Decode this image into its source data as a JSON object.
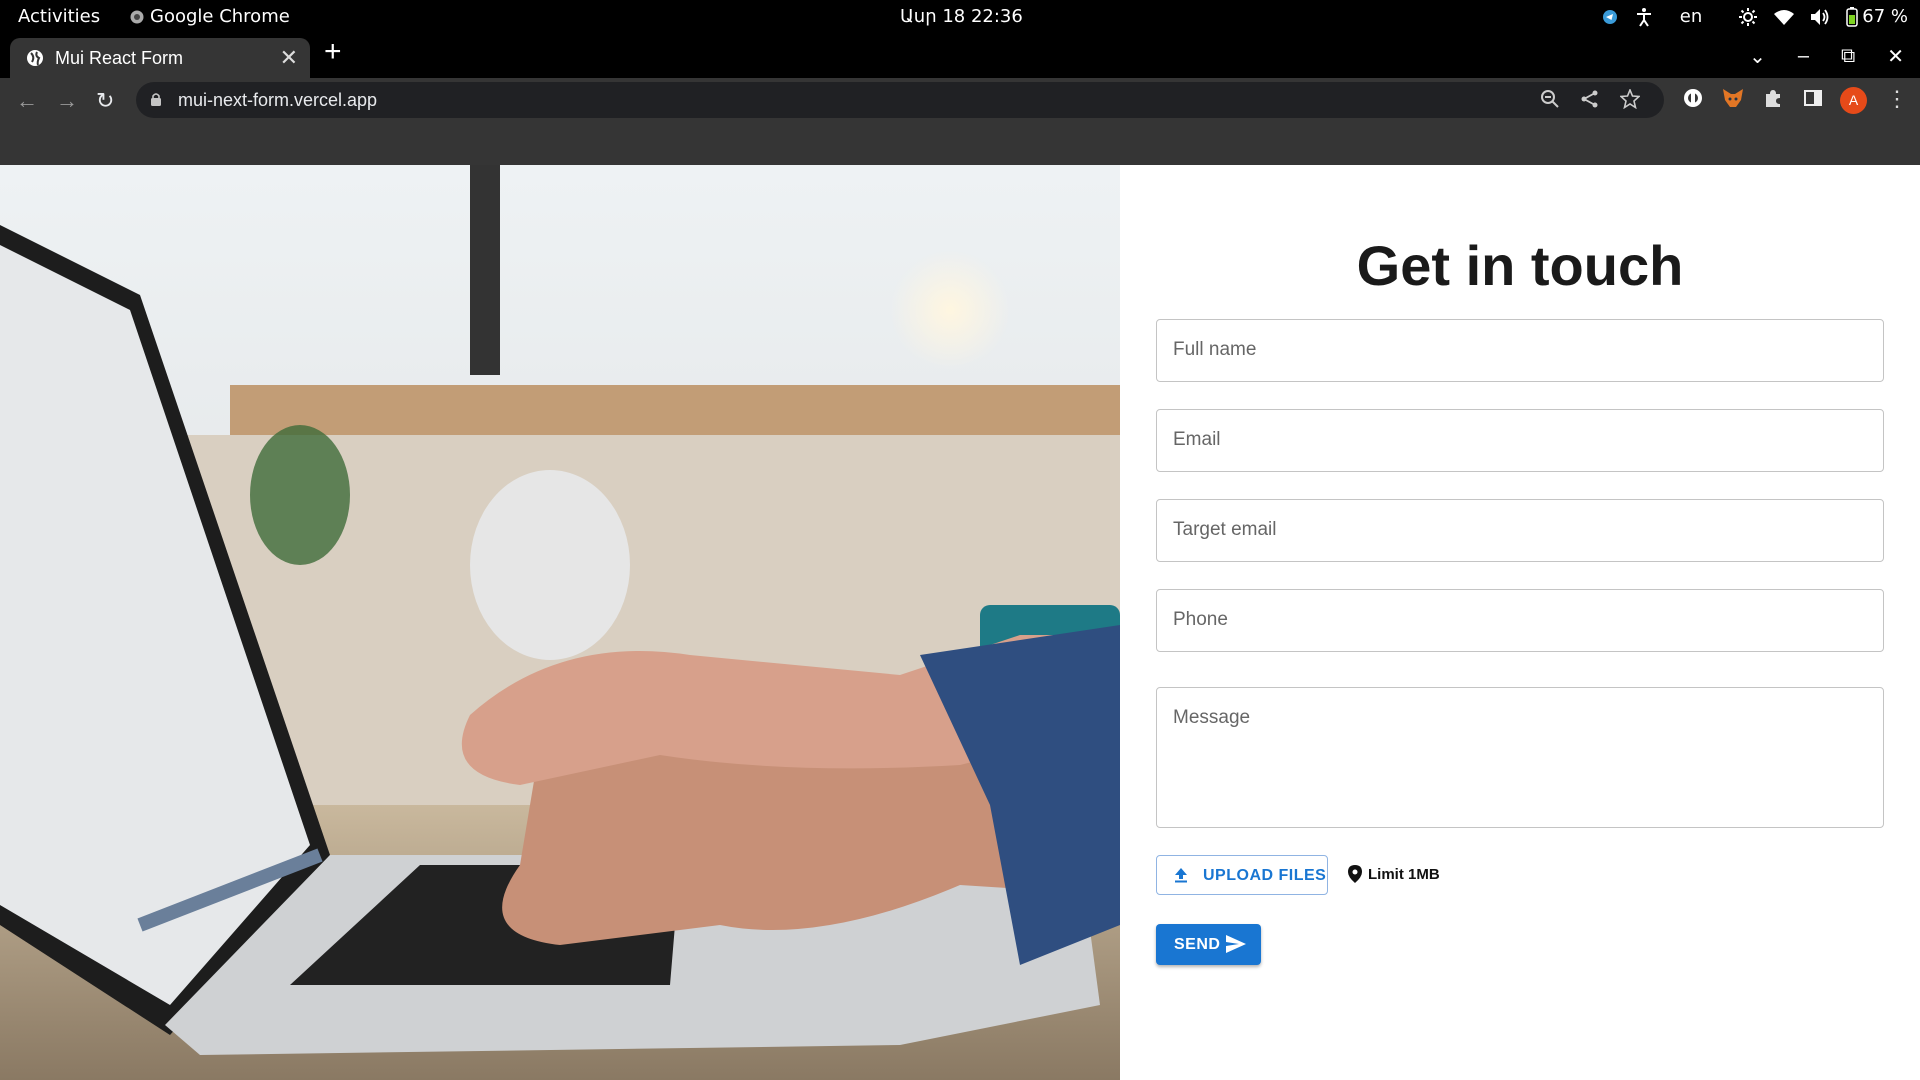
{
  "system_bar": {
    "activities": "Activities",
    "app_name": "Google Chrome",
    "clock": "Աuր 18  22:36",
    "language": "en",
    "battery": "67 %"
  },
  "browser": {
    "tab_title": "Mui React Form",
    "url": "mui-next-form.vercel.app",
    "profile_initial": "A"
  },
  "hero": {
    "image_icon": "laptop-typing-photo"
  },
  "form": {
    "heading": "Get in touch",
    "fields": {
      "full_name": "Full name",
      "email": "Email",
      "target_email": "Target email",
      "phone": "Phone",
      "message": "Message"
    },
    "upload_label": "UPLOAD FILES",
    "limit_text": "Limit 1MB",
    "send_label": "SEND"
  },
  "colors": {
    "primary": "#1976d2",
    "chrome_dark": "#353535",
    "omnibox": "#202124"
  }
}
